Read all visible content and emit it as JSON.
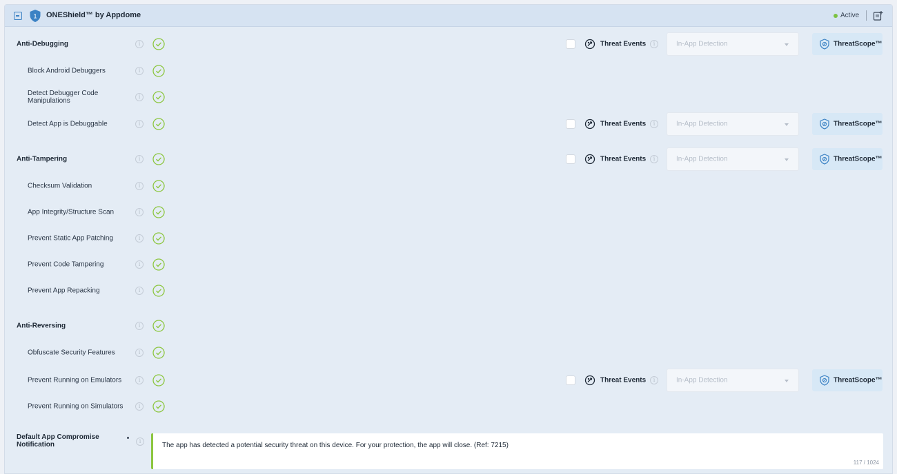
{
  "header": {
    "title": "ONEShield™ by Appdome",
    "step_badge": "1",
    "status": "Active",
    "colors": {
      "status_active": "#7cc242",
      "accent": "#3b82c4"
    }
  },
  "rows": [
    {
      "label": "Anti-Debugging",
      "group": true,
      "threat": {
        "label": "Threat Events",
        "select_value": "In-App Detection",
        "threatscope": "ThreatScope™",
        "checked": false
      }
    },
    {
      "label": "Block Android Debuggers",
      "group": false
    },
    {
      "label": "Detect Debugger Code Manipulations",
      "group": false
    },
    {
      "label": "Detect App is Debuggable",
      "group": false,
      "threat": {
        "label": "Threat Events",
        "select_value": "In-App Detection",
        "threatscope": "ThreatScope™",
        "checked": false
      }
    },
    {
      "label": "Anti-Tampering",
      "group": true,
      "threat": {
        "label": "Threat Events",
        "select_value": "In-App Detection",
        "threatscope": "ThreatScope™",
        "checked": false
      }
    },
    {
      "label": "Checksum Validation",
      "group": false
    },
    {
      "label": "App Integrity/Structure Scan",
      "group": false
    },
    {
      "label": "Prevent Static App Patching",
      "group": false
    },
    {
      "label": "Prevent Code Tampering",
      "group": false
    },
    {
      "label": "Prevent App Repacking",
      "group": false
    },
    {
      "label": "Anti-Reversing",
      "group": true
    },
    {
      "label": "Obfuscate Security Features",
      "group": false
    },
    {
      "label": "Prevent Running on Emulators",
      "group": false,
      "threat": {
        "label": "Threat Events",
        "select_value": "In-App Detection",
        "threatscope": "ThreatScope™",
        "checked": false
      }
    },
    {
      "label": "Prevent Running on Simulators",
      "group": false
    }
  ],
  "notification": {
    "label": "Default App Compromise Notification",
    "text": "The app has detected a potential security threat on this device. For your protection, the app will close. (Ref: 7215)",
    "char_count": "117 / 1024"
  }
}
